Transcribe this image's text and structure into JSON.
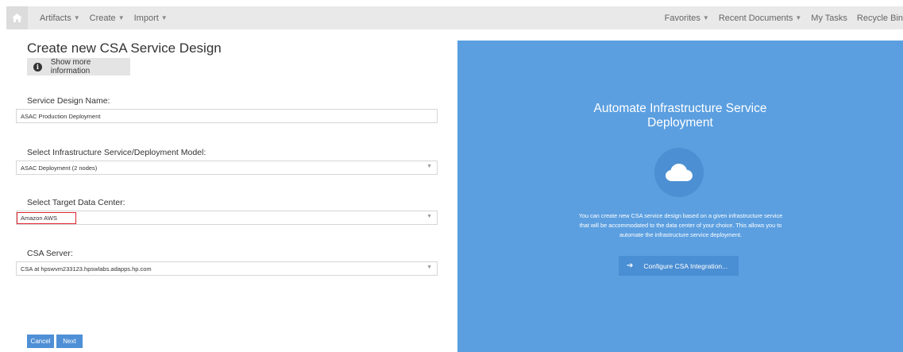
{
  "nav": {
    "left": [
      {
        "label": "Artifacts",
        "dropdown": true
      },
      {
        "label": "Create",
        "dropdown": true
      },
      {
        "label": "Import",
        "dropdown": true
      }
    ],
    "right": [
      {
        "label": "Favorites",
        "dropdown": true
      },
      {
        "label": "Recent Documents",
        "dropdown": true
      },
      {
        "label": "My Tasks",
        "dropdown": false
      },
      {
        "label": "Recycle Bin",
        "dropdown": false
      }
    ]
  },
  "form": {
    "title": "Create new CSA Service Design",
    "info_button": "Show more information",
    "service_name_label": "Service Design Name:",
    "service_name_value": "ASAC Production Deployment",
    "model_label": "Select Infrastructure Service/Deployment Model:",
    "model_value": "ASAC Deployment (2 nodes)",
    "datacenter_label": "Select Target Data Center:",
    "datacenter_value": "Amazon AWS",
    "server_label": "CSA Server:",
    "server_value": "CSA at hpswvm233123.hpswlabs.adapps.hp.com",
    "cancel": "Cancel",
    "next": "Next"
  },
  "panel": {
    "title_line1": "Automate Infrastructure Service",
    "title_line2": "Deployment",
    "description_line1": "You can create new CSA service design based on a given infrastructure service",
    "description_line2": "that will be accommodated to the data center of your choice. This allows you to",
    "description_line3": "automate the infrastructure service deployment.",
    "config_button": "Configure CSA Integration..."
  },
  "colors": {
    "panel_bg": "#5b9fe0",
    "button_bg": "#4f8fd6",
    "highlight": "#e0262e"
  },
  "icons": {
    "home": "home-icon",
    "info": "info-icon",
    "cloud": "cloud-icon",
    "arrow": "arrow-right-icon",
    "caret": "chevron-down-icon"
  }
}
